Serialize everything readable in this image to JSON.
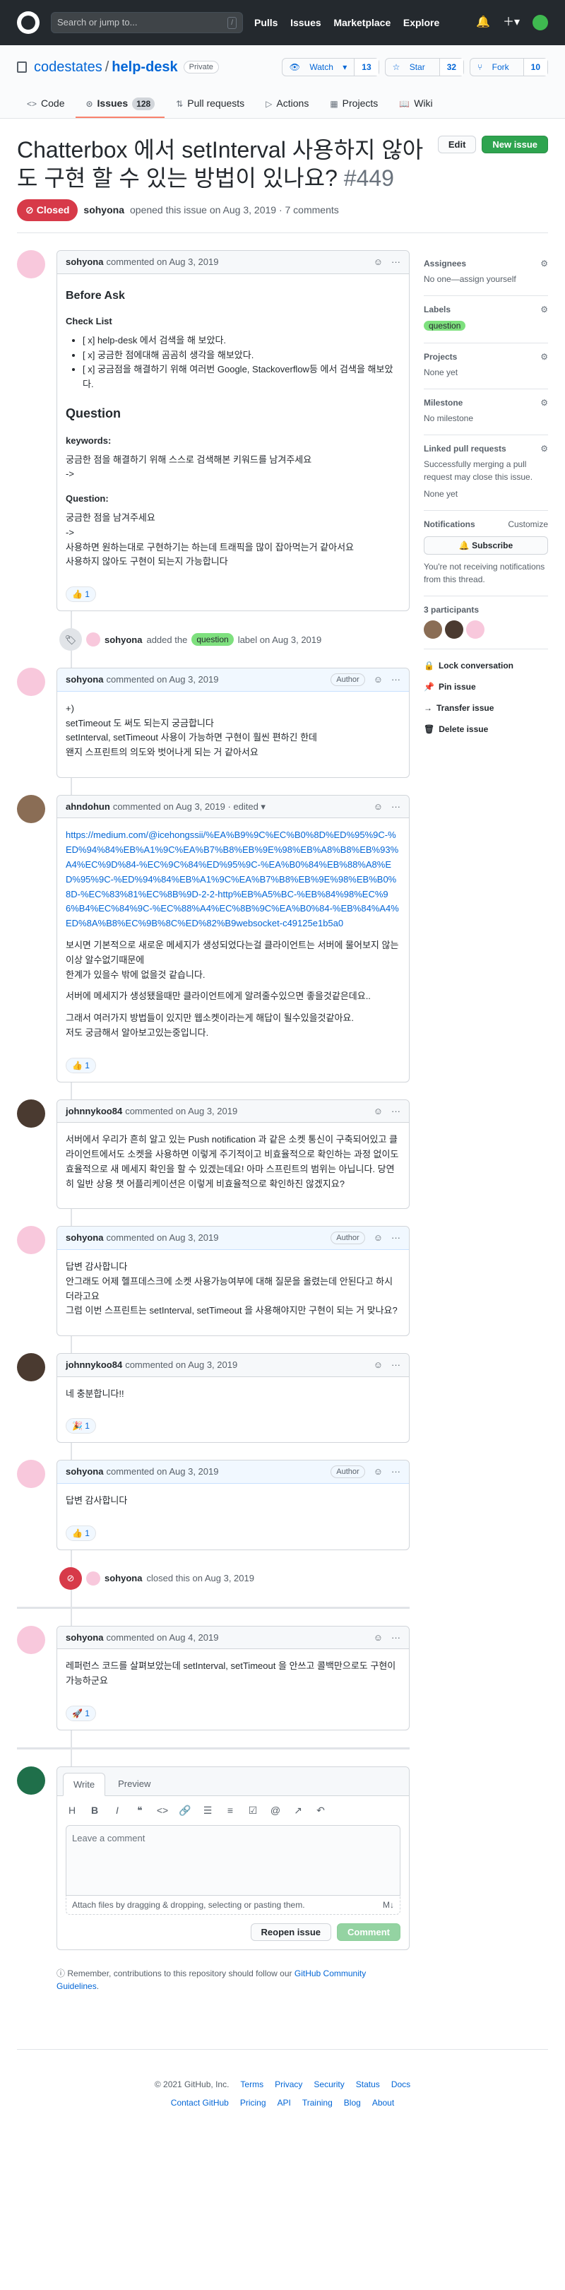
{
  "header": {
    "search_placeholder": "Search or jump to...",
    "search_key": "/",
    "nav": [
      "Pulls",
      "Issues",
      "Marketplace",
      "Explore"
    ]
  },
  "repo": {
    "owner": "codestates",
    "name": "help-desk",
    "visibility": "Private",
    "watch_label": "Watch",
    "watch_count": "13",
    "star_label": "Star",
    "star_count": "32",
    "fork_label": "Fork",
    "fork_count": "10"
  },
  "tabs": [
    {
      "label": "Code"
    },
    {
      "label": "Issues",
      "count": "128"
    },
    {
      "label": "Pull requests"
    },
    {
      "label": "Actions"
    },
    {
      "label": "Projects"
    },
    {
      "label": "Wiki"
    }
  ],
  "issue": {
    "title": "Chatterbox 에서 setInterval 사용하지 않아도 구현 할 수 있는 방법이 있나요?",
    "number": "#449",
    "edit_label": "Edit",
    "new_label": "New issue",
    "state": "Closed",
    "author": "sohyona",
    "meta": "opened this issue on Aug 3, 2019 · 7 comments"
  },
  "first": {
    "author": "sohyona",
    "when": "commented on Aug 3, 2019",
    "h_before": "Before Ask",
    "h_check": "Check List",
    "checks": [
      "[ x] help-desk 에서 검색을 해 보았다.",
      "[ x] 궁금한 점에대해 곰곰히 생각을 해보았다.",
      "[ x] 궁금점을 해결하기 위해 여러번 Google, Stackoverflow등 에서 검색을 해보았다."
    ],
    "h_question": "Question",
    "h_keywords": "keywords:",
    "kw1": "궁금한 점을 해결하기 위해 스스로 검색해본 키워드를 남겨주세요",
    "kw2": "->",
    "h_q2": "Question:",
    "q1": "궁금한 점을 남겨주세요",
    "q2": "->",
    "q3": "사용하면 원하는대로 구현하기는 하는데 트래픽을 많이 잡아먹는거 같아서요",
    "q4": "사용하지 않아도 구현이 되는지 가능합니다",
    "react": "👍 1"
  },
  "label_event": {
    "author": "sohyona",
    "pre": "added the",
    "label": "question",
    "post": "label on Aug 3, 2019"
  },
  "c2": {
    "author": "sohyona",
    "when": "commented on Aug 3, 2019",
    "badge": "Author",
    "l1": "+)",
    "l2": "setTimeout 도 써도 되는지 궁금합니다",
    "l3": "setInterval, setTimeout 사용이 가능하면 구현이 훨씬 편하긴 한데",
    "l4": "왠지 스프린트의 의도와 벗어나게 되는 거 같아서요"
  },
  "c3": {
    "author": "ahndohun",
    "when": "commented on Aug 3, 2019 · edited ▾",
    "link": "https://medium.com/@icehongssii/%EA%B9%9C%EC%B0%8D%ED%95%9C-%ED%94%84%EB%A1%9C%EA%B7%B8%EB%9E%98%EB%A8%B8%EB%93%A4%EC%9D%84-%EC%9C%84%ED%95%9C-%EA%B0%84%EB%88%A8%ED%95%9C-%ED%94%84%EB%A1%9C%EA%B7%B8%EB%9E%98%EB%B0%8D-%EC%83%81%EC%8B%9D-2-2-http%EB%A5%BC-%EB%84%98%EC%96%B4%EC%84%9C-%EC%88%A4%EC%8B%9C%EA%B0%84-%EB%84%A4%ED%8A%B8%EC%9B%8C%ED%82%B9websocket-c49125e1b5a0",
    "p1a": "보시면 기본적으로 새로운 메세지가 생성되었다는걸 클라이언트는 서버에 물어보지 않는이상 알수없기때문에",
    "p1b": "한계가 있을수 밖에 없을것 같습니다.",
    "p2": "서버에 메세지가 생성됐을때만 클라이언트에게 알려줄수있으면 좋을것같은데요..",
    "p3a": "그래서 여러가지 방법들이 있지만 웹소켓이라는게 해답이 될수있을것같아요.",
    "p3b": "저도 궁금해서 알아보고있는중입니다.",
    "react": "👍 1"
  },
  "c4": {
    "author": "johnnykoo84",
    "when": "commented on Aug 3, 2019",
    "text": "서버에서 우리가 흔히 알고 있는 Push notification 과 같은 소켓 통신이 구축되어있고 클라이언트에서도 소켓을 사용하면 이렇게 주기적이고 비효율적으로 확인하는 과정 없이도 효율적으로 새 메세지 확인을 할 수 있겠는데요! 아마 스프린트의 범위는 아닙니다. 당연히 일반 상용 챗 어플리케이션은 이렇게 비효율적으로 확인하진 않겠지요?"
  },
  "c5": {
    "author": "sohyona",
    "when": "commented on Aug 3, 2019",
    "badge": "Author",
    "l1": "답변 감사합니다",
    "l2": "안그래도 어제 헬프데스크에 소켓 사용가능여부에 대해 질문을 올렸는데 안된다고 하시더라고요",
    "l3": "그럼 이번 스프린트는 setInterval, setTimeout 을 사용해야지만 구현이 되는 거 맞나요?"
  },
  "c6": {
    "author": "johnnykoo84",
    "when": "commented on Aug 3, 2019",
    "text": "네 충분합니다!!",
    "react": "🎉 1"
  },
  "c7": {
    "author": "sohyona",
    "when": "commented on Aug 3, 2019",
    "badge": "Author",
    "text": "답변 감사합니다",
    "react": "👍 1"
  },
  "close_event": {
    "author": "sohyona",
    "text": "closed this on Aug 3, 2019"
  },
  "c8": {
    "author": "sohyona",
    "when": "commented on Aug 4, 2019",
    "text": "레퍼런스 코드를 살펴보았는데 setInterval, setTimeout 을 안쓰고 콜백만으로도 구현이 가능하군요",
    "react": "🚀 1"
  },
  "composer": {
    "write": "Write",
    "preview": "Preview",
    "placeholder": "Leave a comment",
    "attach": "Attach files by dragging & dropping, selecting or pasting them.",
    "md": "M↓",
    "reopen": "Reopen issue",
    "comment": "Comment",
    "note_pre": "Remember, contributions to this repository should follow our",
    "note_link": "GitHub Community Guidelines",
    "note_post": "."
  },
  "sidebar": {
    "assignees": "Assignees",
    "assignees_val": "No one—assign yourself",
    "labels": "Labels",
    "label_val": "question",
    "projects": "Projects",
    "projects_val": "None yet",
    "milestone": "Milestone",
    "milestone_val": "No milestone",
    "linked": "Linked pull requests",
    "linked_desc": "Successfully merging a pull request may close this issue.",
    "linked_val": "None yet",
    "notifications": "Notifications",
    "customize": "Customize",
    "subscribe": "Subscribe",
    "notif_desc": "You're not receiving notifications from this thread.",
    "participants": "3 participants",
    "lock": "Lock conversation",
    "pin": "Pin issue",
    "transfer": "Transfer issue",
    "delete": "Delete issue"
  },
  "footer": {
    "row1": [
      "© 2021 GitHub, Inc.",
      "Terms",
      "Privacy",
      "Security",
      "Status",
      "Docs"
    ],
    "row2": [
      "Contact GitHub",
      "Pricing",
      "API",
      "Training",
      "Blog",
      "About"
    ]
  },
  "colors": {
    "closed": "#d73a49",
    "green": "#2ea44f",
    "label": "#7ee07e"
  }
}
